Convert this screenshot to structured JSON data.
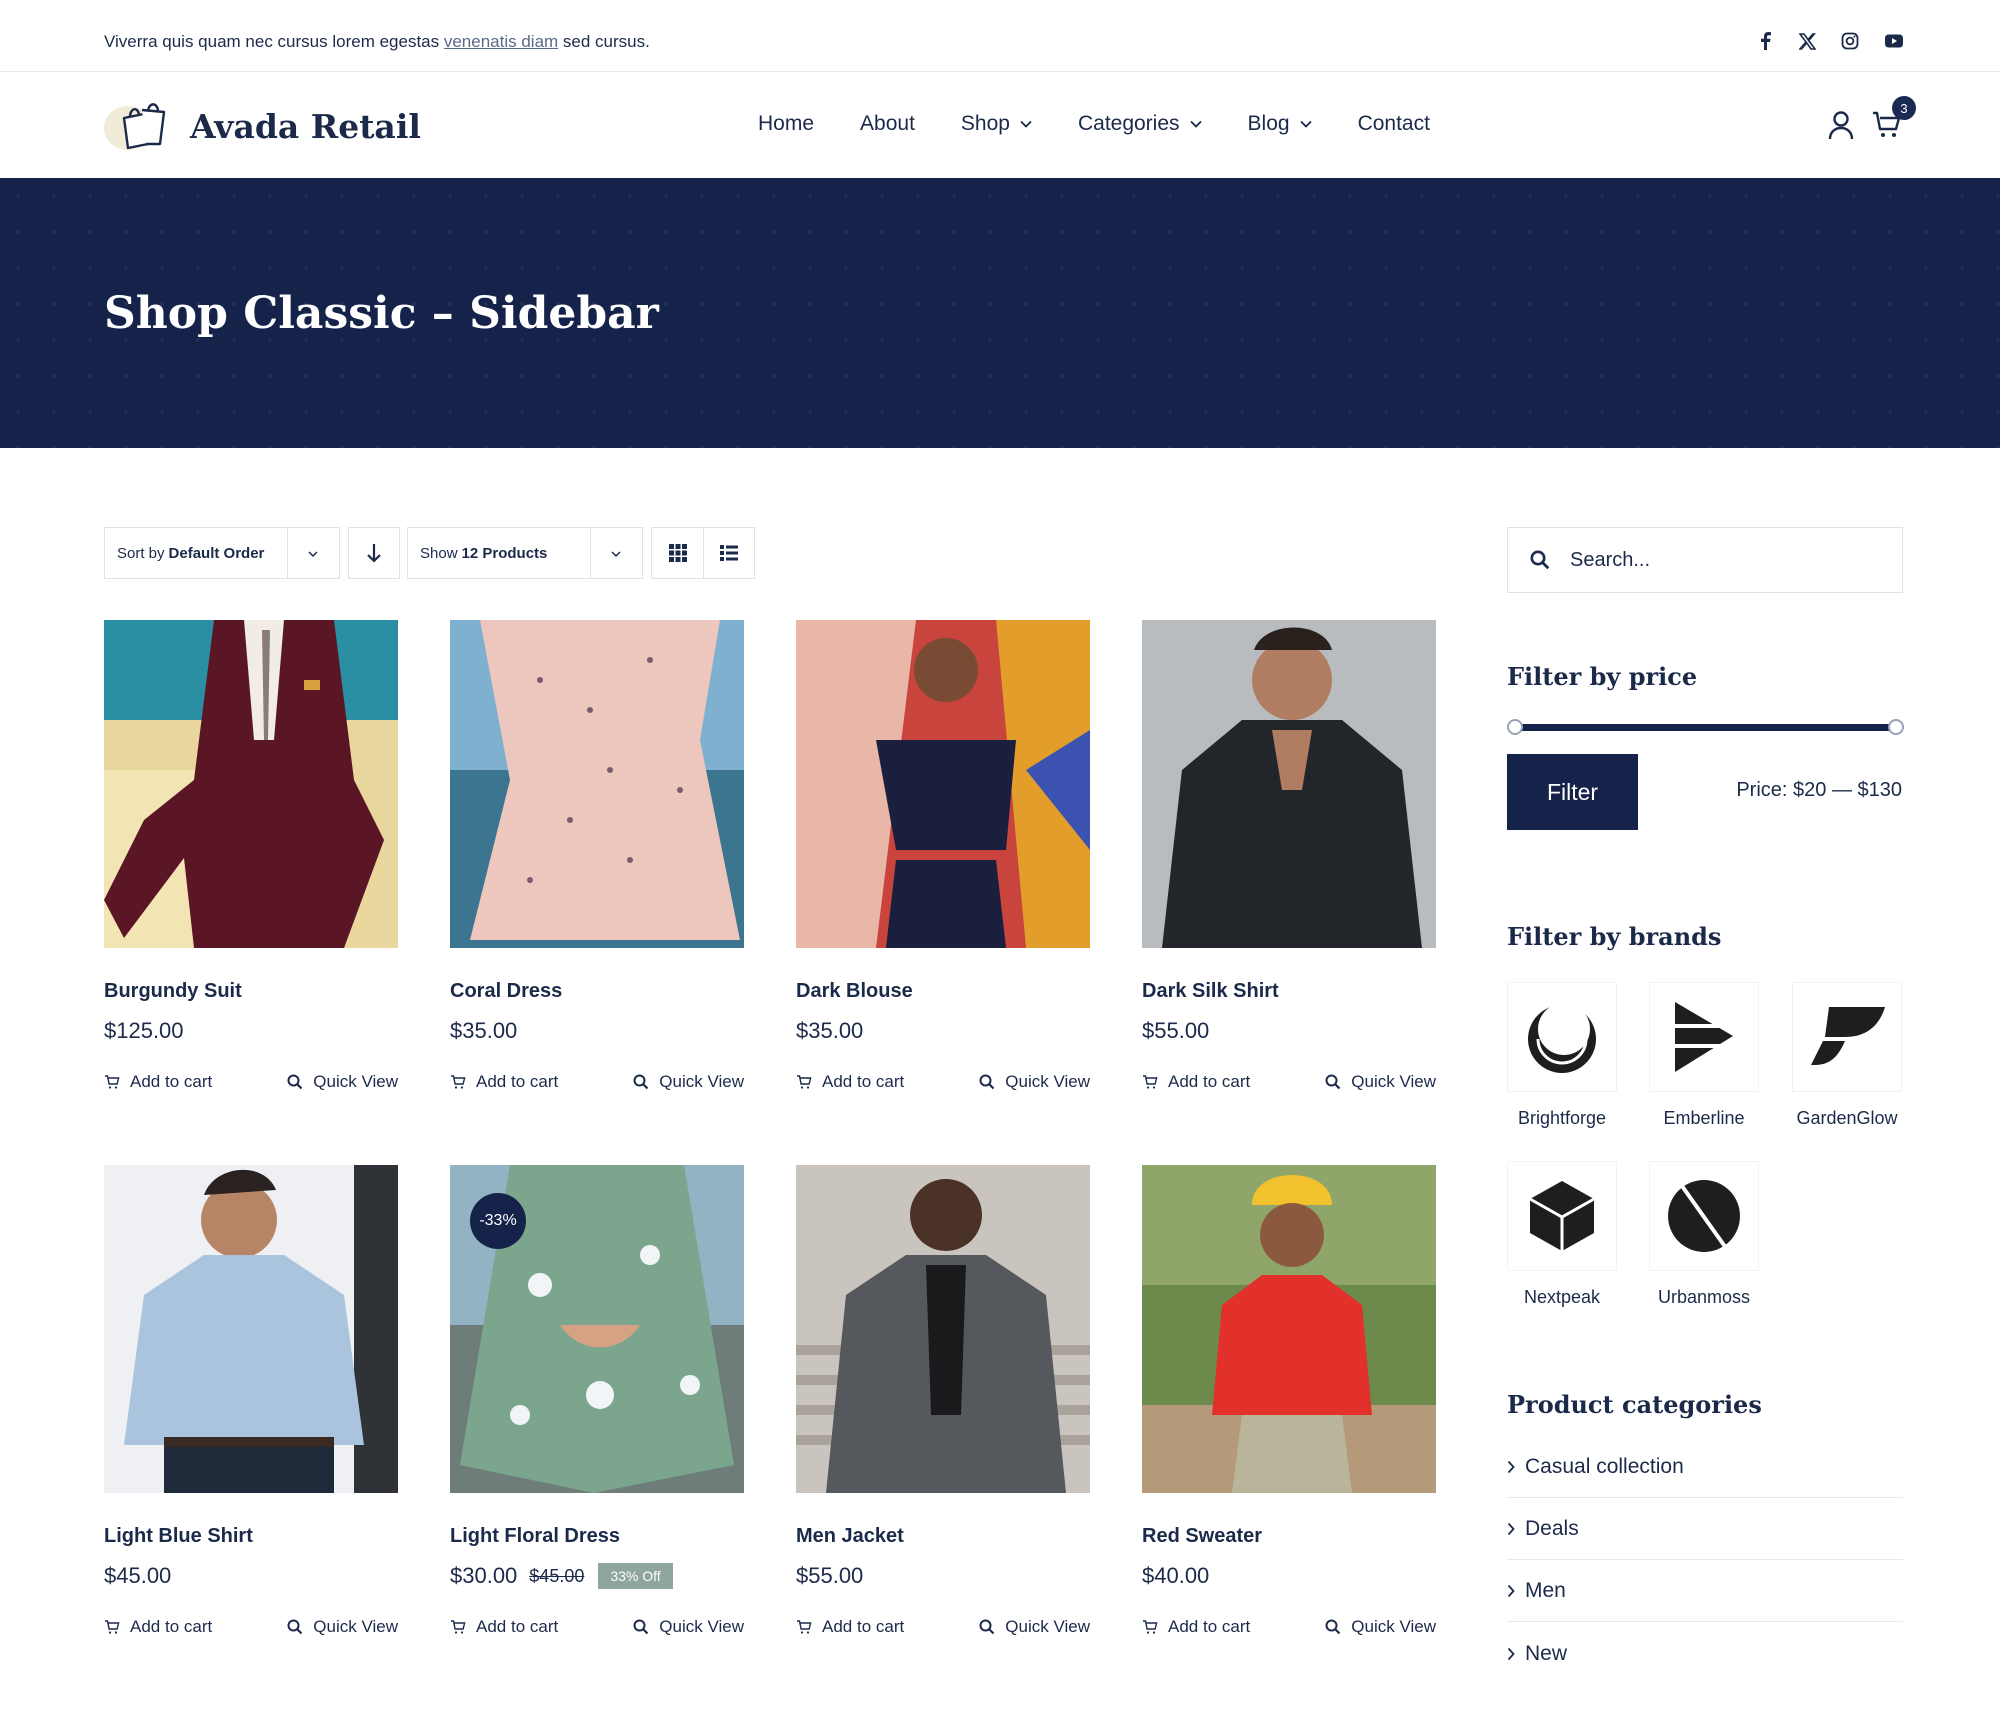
{
  "topbar": {
    "text_before": "Viverra quis quam nec cursus lorem egestas ",
    "link": "venenatis diam",
    "text_after": " sed cursus."
  },
  "header": {
    "logo": "Avada Retail",
    "nav": [
      {
        "label": "Home"
      },
      {
        "label": "About"
      },
      {
        "label": "Shop"
      },
      {
        "label": "Categories"
      },
      {
        "label": "Blog"
      },
      {
        "label": "Contact"
      }
    ],
    "cart_count": "3"
  },
  "hero": {
    "title": "Shop Classic – Sidebar"
  },
  "toolbar": {
    "sort_prefix": "Sort by",
    "sort_value": "Default Order",
    "show_prefix": "Show",
    "show_value": "12 Products"
  },
  "products": [
    {
      "name": "Burgundy Suit",
      "price": "$125.00",
      "add": "Add to cart",
      "quick": "Quick View"
    },
    {
      "name": "Coral Dress",
      "price": "$35.00",
      "add": "Add to cart",
      "quick": "Quick View"
    },
    {
      "name": "Dark Blouse",
      "price": "$35.00",
      "add": "Add to cart",
      "quick": "Quick View"
    },
    {
      "name": "Dark Silk Shirt",
      "price": "$55.00",
      "add": "Add to cart",
      "quick": "Quick View"
    },
    {
      "name": "Light Blue Shirt",
      "price": "$45.00",
      "add": "Add to cart",
      "quick": "Quick View"
    },
    {
      "name": "Light Floral Dress",
      "price": "$30.00",
      "old_price": "$45.00",
      "off_badge": "33% Off",
      "sale_badge": "-33%",
      "add": "Add to cart",
      "quick": "Quick View"
    },
    {
      "name": "Men Jacket",
      "price": "$55.00",
      "add": "Add to cart",
      "quick": "Quick View"
    },
    {
      "name": "Red Sweater",
      "price": "$40.00",
      "add": "Add to cart",
      "quick": "Quick View"
    }
  ],
  "sidebar": {
    "search_placeholder": "Search...",
    "price_heading": "Filter by price",
    "filter_button": "Filter",
    "price_range": "Price:  $20 — $130",
    "brands_heading": "Filter by brands",
    "brands": [
      {
        "label": "Brightforge"
      },
      {
        "label": "Emberline"
      },
      {
        "label": "GardenGlow"
      },
      {
        "label": "Nextpeak"
      },
      {
        "label": "Urbanmoss"
      }
    ],
    "categories_heading": "Product categories",
    "categories": [
      {
        "label": "Casual collection"
      },
      {
        "label": "Deals"
      },
      {
        "label": "Men"
      },
      {
        "label": "New"
      }
    ]
  },
  "colors": {
    "navy": "#15224a",
    "text": "#1c2a4a",
    "off_badge": "#8fa5a0"
  }
}
